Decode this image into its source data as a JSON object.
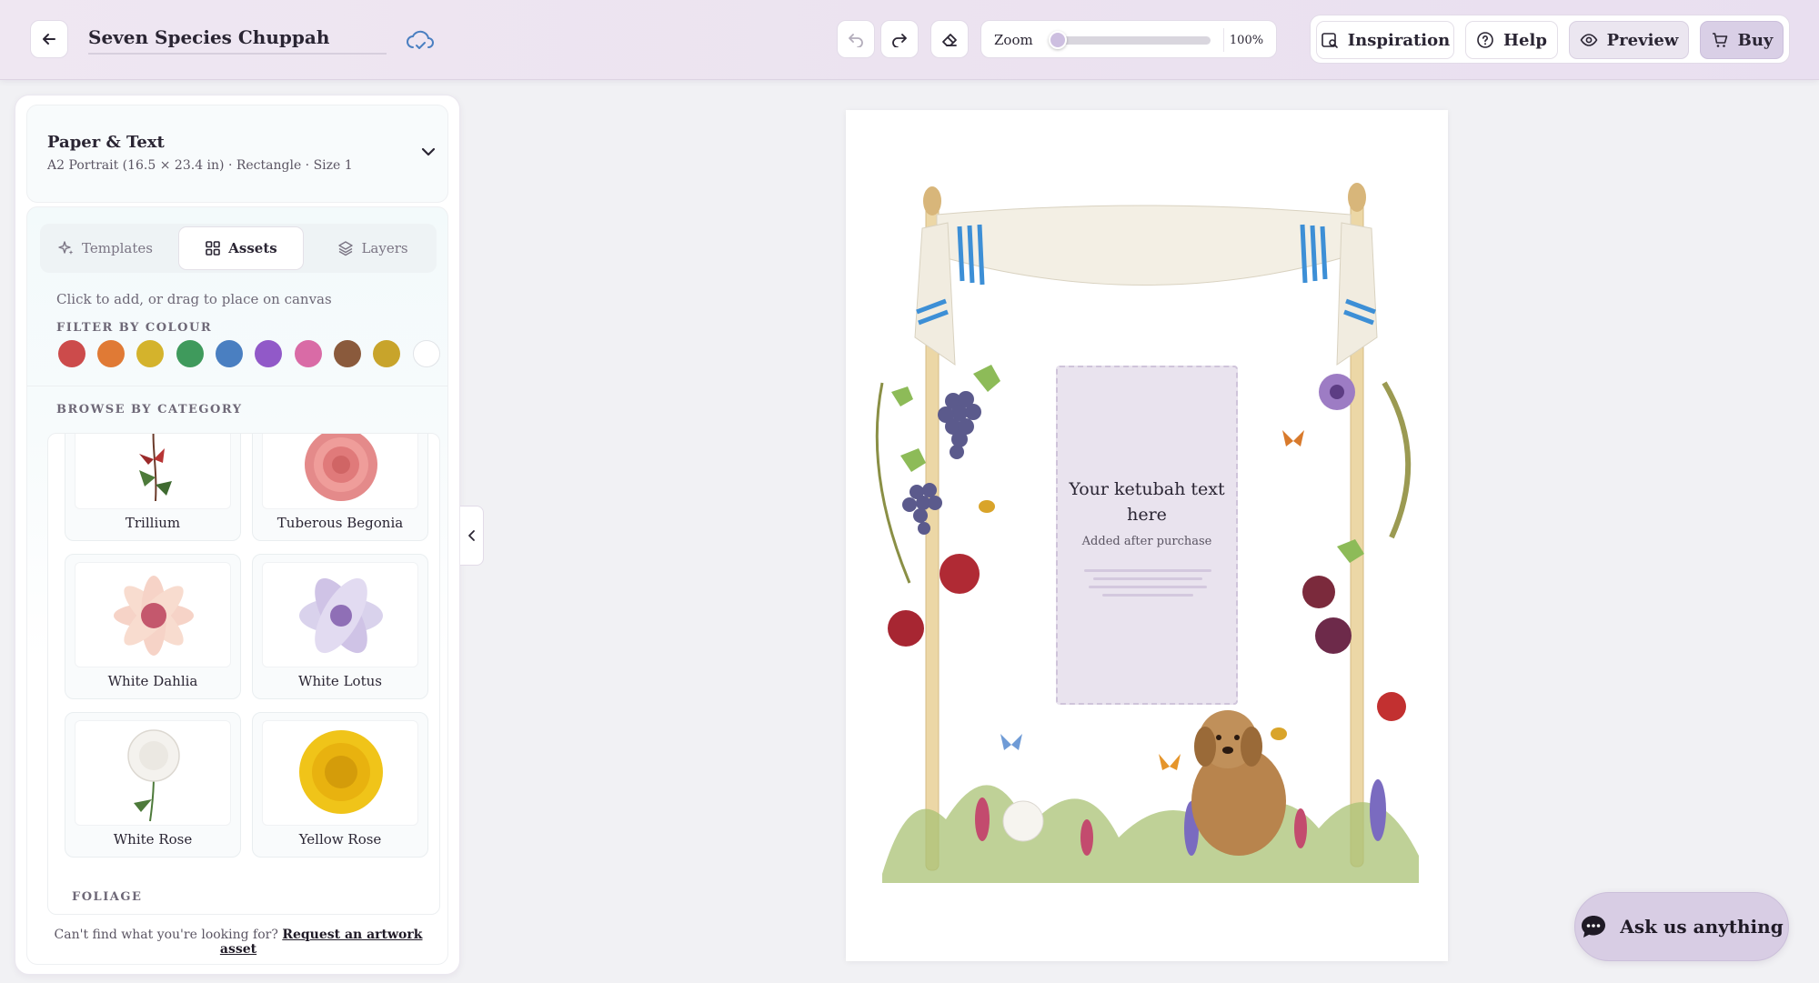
{
  "header": {
    "document_title": "Seven Species Chuppah",
    "zoom_label": "Zoom",
    "zoom_value": "100%",
    "zoom_level_percent": 100,
    "inspiration_label": "Inspiration",
    "help_label": "Help",
    "preview_label": "Preview",
    "buy_label": "Buy"
  },
  "paper": {
    "title": "Paper & Text",
    "subtitle": "A2 Portrait (16.5 × 23.4 in) · Rectangle · Size 1"
  },
  "tabs": [
    {
      "label": "Templates",
      "icon": "sparkle-icon",
      "active": false
    },
    {
      "label": "Assets",
      "icon": "grid-icon",
      "active": true
    },
    {
      "label": "Layers",
      "icon": "layers-icon",
      "active": false
    }
  ],
  "assets": {
    "hint": "Click to add, or drag to place on canvas",
    "filter_label": "FILTER BY COLOUR",
    "colours": [
      "#cc4b4b",
      "#e07a35",
      "#d4b32c",
      "#3f9a5c",
      "#4a7fc1",
      "#9159c8",
      "#d96ba6",
      "#8a5a3c",
      "#c8a42b",
      "#ffffff"
    ],
    "browse_label": "BROWSE BY CATEGORY",
    "items": [
      {
        "label": "Trillium"
      },
      {
        "label": "Tuberous Begonia"
      },
      {
        "label": "White Dahlia"
      },
      {
        "label": "White Lotus"
      },
      {
        "label": "White Rose"
      },
      {
        "label": "Yellow Rose"
      }
    ],
    "next_category": "FOLIAGE",
    "request_prefix": "Can't find what you're looking for?",
    "request_link": "Request an artwork asset"
  },
  "canvas": {
    "text_title": "Your ketubah text here",
    "text_sub": "Added after purchase"
  },
  "chat": {
    "label": "Ask us anything"
  }
}
